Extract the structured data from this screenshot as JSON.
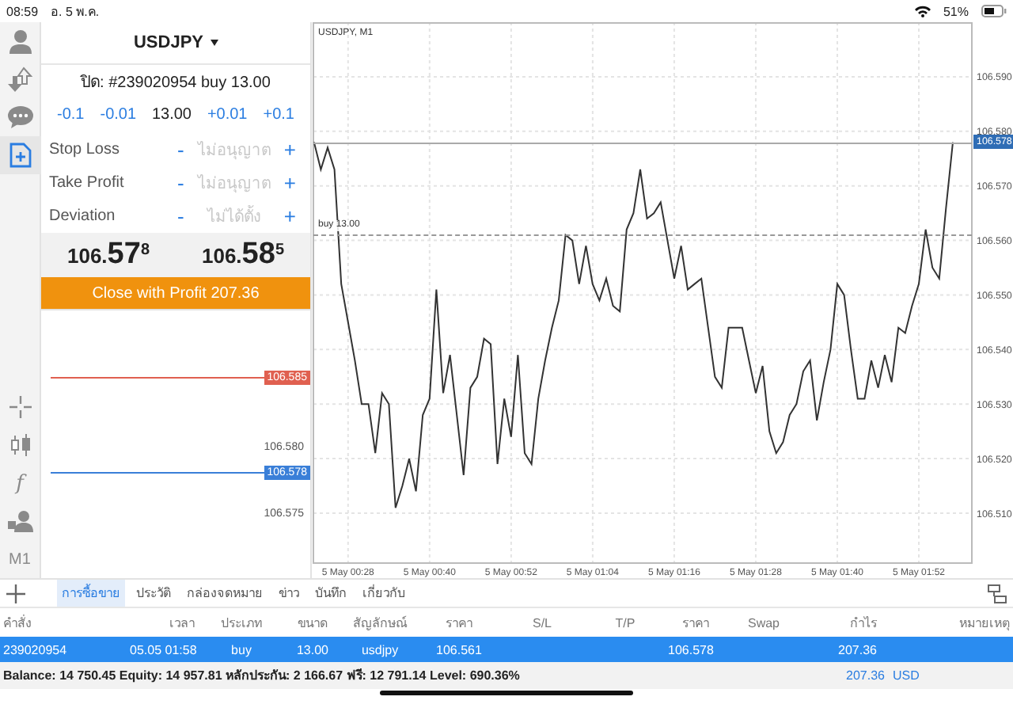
{
  "status_bar": {
    "time": "08:59",
    "date": "อ. 5 พ.ค.",
    "battery": "51%"
  },
  "toolbar": {
    "top": [
      {
        "kind": "person",
        "selected": false
      },
      {
        "kind": "arrows",
        "selected": false
      },
      {
        "kind": "chat",
        "selected": false
      },
      {
        "kind": "new-order",
        "selected": true
      }
    ],
    "bottom": [
      {
        "kind": "crosshair"
      },
      {
        "kind": "candles"
      },
      {
        "kind": "text",
        "label": "f"
      },
      {
        "kind": "people"
      },
      {
        "kind": "text",
        "label": "M1"
      }
    ]
  },
  "order_panel": {
    "symbol": "USDJPY",
    "info": "ปิด: #239020954 buy 13.00",
    "volume": {
      "steps_down": [
        "-0.1",
        "-0.01"
      ],
      "value": "13.00",
      "steps_up": [
        "+0.01",
        "+0.1"
      ]
    },
    "params": [
      {
        "label": "Stop Loss",
        "minus": "-",
        "value": "ไม่อนุญาต",
        "plus": "+"
      },
      {
        "label": "Take Profit",
        "minus": "-",
        "value": "ไม่อนุญาต",
        "plus": "+"
      },
      {
        "label": "Deviation",
        "minus": "-",
        "value": "ไม่ได้ตั้ง",
        "plus": "+"
      }
    ],
    "prices": [
      {
        "prefix": "106.",
        "big": "57",
        "sup": "8"
      },
      {
        "prefix": "106.",
        "big": "58",
        "sup": "5"
      }
    ],
    "close_button": "Close with Profit 207.36"
  },
  "price_scale": [
    {
      "kind": "line",
      "label": "106.585",
      "color": "#e06050"
    },
    {
      "kind": "label",
      "label": "106.580"
    },
    {
      "kind": "line",
      "label": "106.578",
      "color": "#3a7fd8"
    },
    {
      "kind": "label",
      "label": "106.575"
    }
  ],
  "chart_data": {
    "type": "line",
    "title": "USDJPY, M1",
    "categories": [
      null,
      null,
      null,
      null,
      null,
      "5 May 00:28",
      null,
      null,
      null,
      null,
      null,
      null,
      null,
      null,
      null,
      null,
      null,
      "5 May 00:40",
      null,
      null,
      null,
      null,
      null,
      null,
      null,
      null,
      null,
      null,
      null,
      "5 May 00:52",
      null,
      null,
      null,
      null,
      null,
      null,
      null,
      null,
      null,
      null,
      null,
      "5 May 01:04",
      null,
      null,
      null,
      null,
      null,
      null,
      null,
      null,
      null,
      null,
      null,
      "5 May 01:16",
      null,
      null,
      null,
      null,
      null,
      null,
      null,
      null,
      null,
      null,
      null,
      "5 May 01:28",
      null,
      null,
      null,
      null,
      null,
      null,
      null,
      null,
      null,
      null,
      null,
      "5 May 01:40",
      null,
      null,
      null,
      null,
      null,
      null,
      null,
      null,
      null,
      null,
      null,
      "5 May 01:52",
      null,
      null,
      null,
      null,
      null
    ],
    "series": [
      {
        "color": "#333333",
        "values": [
          106.578,
          106.573,
          106.577,
          106.573,
          106.552,
          106.545,
          106.538,
          106.53,
          106.53,
          106.521,
          106.532,
          106.53,
          106.511,
          106.515,
          106.52,
          106.514,
          106.528,
          106.531,
          106.551,
          106.532,
          106.539,
          106.528,
          106.517,
          106.533,
          106.535,
          106.542,
          106.541,
          106.519,
          106.531,
          106.524,
          106.539,
          106.521,
          106.519,
          106.531,
          106.538,
          106.544,
          106.549,
          106.561,
          106.56,
          106.552,
          106.559,
          106.552,
          106.549,
          106.553,
          106.548,
          106.547,
          106.562,
          106.565,
          106.573,
          106.564,
          106.565,
          106.567,
          106.56,
          106.553,
          106.559,
          106.551,
          106.552,
          106.553,
          106.544,
          106.535,
          106.533,
          106.544,
          106.544,
          106.544,
          106.538,
          106.532,
          106.537,
          106.525,
          106.521,
          106.523,
          106.528,
          106.53,
          106.536,
          106.538,
          106.527,
          106.534,
          106.54,
          106.552,
          106.55,
          106.54,
          106.531,
          106.531,
          106.538,
          106.533,
          106.539,
          106.534,
          106.544,
          106.543,
          106.548,
          106.552,
          106.562,
          106.555,
          106.553,
          106.566,
          106.578
        ]
      }
    ],
    "ylim": [
      106.501,
      106.6
    ],
    "yticks": [
      {
        "value": 106.51,
        "label": "106.510"
      },
      {
        "value": 106.52,
        "label": "106.520"
      },
      {
        "value": 106.53,
        "label": "106.530"
      },
      {
        "value": 106.54,
        "label": "106.540"
      },
      {
        "value": 106.55,
        "label": "106.550"
      },
      {
        "value": 106.56,
        "label": "106.560"
      },
      {
        "value": 106.57,
        "label": "106.570"
      },
      {
        "value": 106.58,
        "label": "106.580"
      },
      {
        "value": 106.59,
        "label": "106.590"
      }
    ],
    "grid": true
  },
  "chart_marks": {
    "price_tag": "106.578",
    "order_label": "buy 13.00"
  },
  "bottom_tabs": [
    {
      "label": "การซื้อขาย",
      "selected": true
    },
    {
      "label": "ประวัติ",
      "selected": false
    },
    {
      "label": "กล่องจดหมาย",
      "selected": false
    },
    {
      "label": "ข่าว",
      "selected": false
    },
    {
      "label": "บันทึก",
      "selected": false
    },
    {
      "label": "เกี่ยวกับ",
      "selected": false
    }
  ],
  "table": {
    "columns": [
      "คำสั่ง",
      "เวลา",
      "ประเภท",
      "ขนาด",
      "สัญลักษณ์",
      "ราคา",
      "S/L",
      "T/P",
      "ราคา",
      "Swap",
      "กำไร",
      "หมายเหตุ"
    ],
    "rows": [
      {
        "order": "239020954",
        "time": "05.05 01:58",
        "type": "buy",
        "volume": "13.00",
        "symbol": "usdjpy",
        "open_price": "106.561",
        "price": "106.578",
        "profit": "207.36",
        "selected": true
      }
    ]
  },
  "summary": {
    "text": "Balance: 14 750.45 Equity: 14 957.81 หลักประกัน: 2 166.67 ฟรี: 12 791.14 Level: 690.36%",
    "profit": "207.36",
    "currency": "USD"
  }
}
